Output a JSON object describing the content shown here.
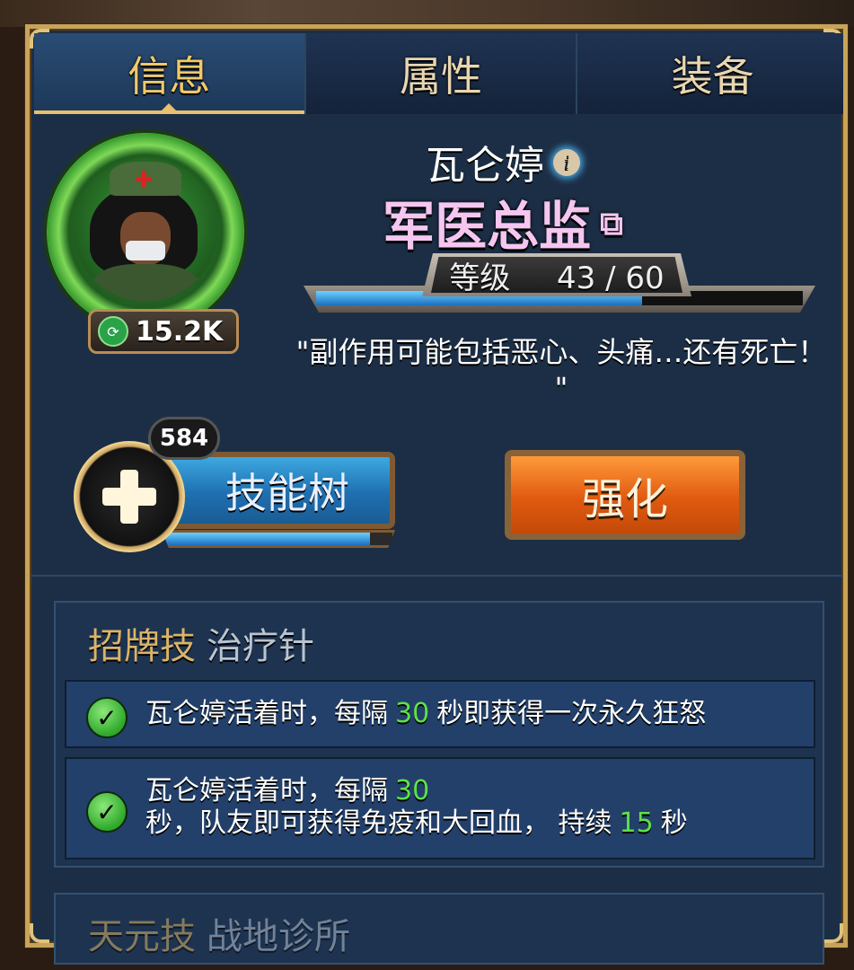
{
  "tabs": [
    {
      "label": "信息",
      "active": true
    },
    {
      "label": "属性",
      "active": false
    },
    {
      "label": "装备",
      "active": false
    }
  ],
  "character": {
    "name": "瓦仑婷",
    "title": "军医总监",
    "power": "15.2K",
    "level_label": "等级",
    "level": 43,
    "level_max": 60,
    "level_sep": "/",
    "xp_fraction": 0.67,
    "quote": "\"副作用可能包括恶心、头痛…还有死亡！ \""
  },
  "actions": {
    "skill_tree_label": "技能树",
    "skill_points": "584",
    "skill_progress_fraction": 0.9,
    "enhance_label": "强化"
  },
  "signature": {
    "kind": "招牌技",
    "name": "治疗针",
    "effect1": {
      "pre": "瓦仑婷活着时，每隔",
      "num": "30",
      "post": "秒即获得一次永久狂怒"
    },
    "effect2": {
      "line1_pre": "瓦仑婷活着时，每隔",
      "line1_num": "30",
      "line2_pre": "秒，队友即可获得免疫和大回血，  持续",
      "line2_num": "15",
      "line2_post": "秒"
    }
  },
  "next_section": {
    "kind": "天元技",
    "name": "战地诊所"
  },
  "colors": {
    "accent_gold": "#c7a459",
    "highlight_green": "#5ee04a",
    "title_pink": "#f4c6f0",
    "enhance_orange": "#e05a10",
    "skill_blue": "#1f6fb0"
  }
}
